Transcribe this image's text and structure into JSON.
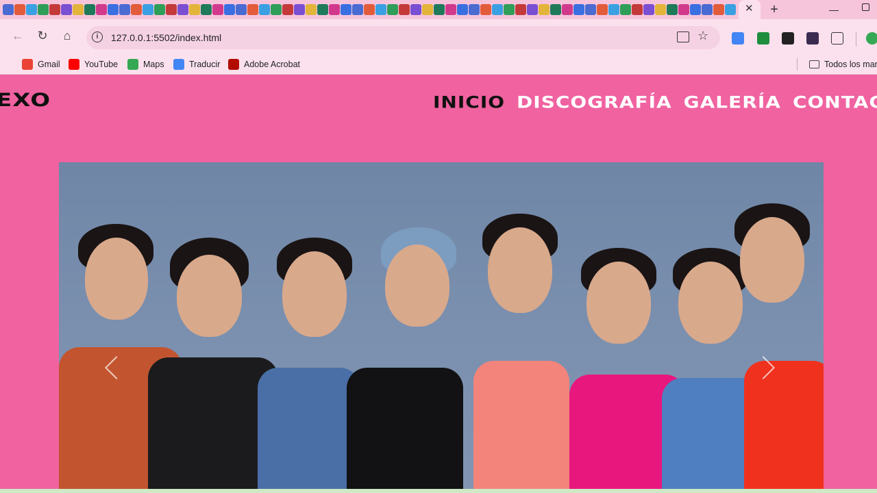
{
  "browser": {
    "url": "127.0.0.1:5502/index.html",
    "tab_close": "✕",
    "new_tab": "+",
    "bookmarks": [
      {
        "label": "Gmail",
        "icon": "gmail-icon",
        "color": "#ea4335"
      },
      {
        "label": "YouTube",
        "icon": "youtube-icon",
        "color": "#ff0000"
      },
      {
        "label": "Maps",
        "icon": "maps-icon",
        "color": "#34a853"
      },
      {
        "label": "Traducir",
        "icon": "translate-icon",
        "color": "#4285f4"
      },
      {
        "label": "Adobe Acrobat",
        "icon": "acrobat-icon",
        "color": "#b30b00"
      }
    ],
    "all_bookmarks_label": "Todos los marcadores"
  },
  "site": {
    "logo": "EXO",
    "nav": [
      {
        "label": "INICIO",
        "active": true
      },
      {
        "label": "DISCOGRAFÍA",
        "active": false
      },
      {
        "label": "GALERÍA",
        "active": false
      },
      {
        "label": "CONTACTO",
        "active": false
      }
    ],
    "colors": {
      "page_bg": "#f062a0",
      "nav_active": "#111111",
      "nav_inactive": "#ffffff"
    }
  }
}
